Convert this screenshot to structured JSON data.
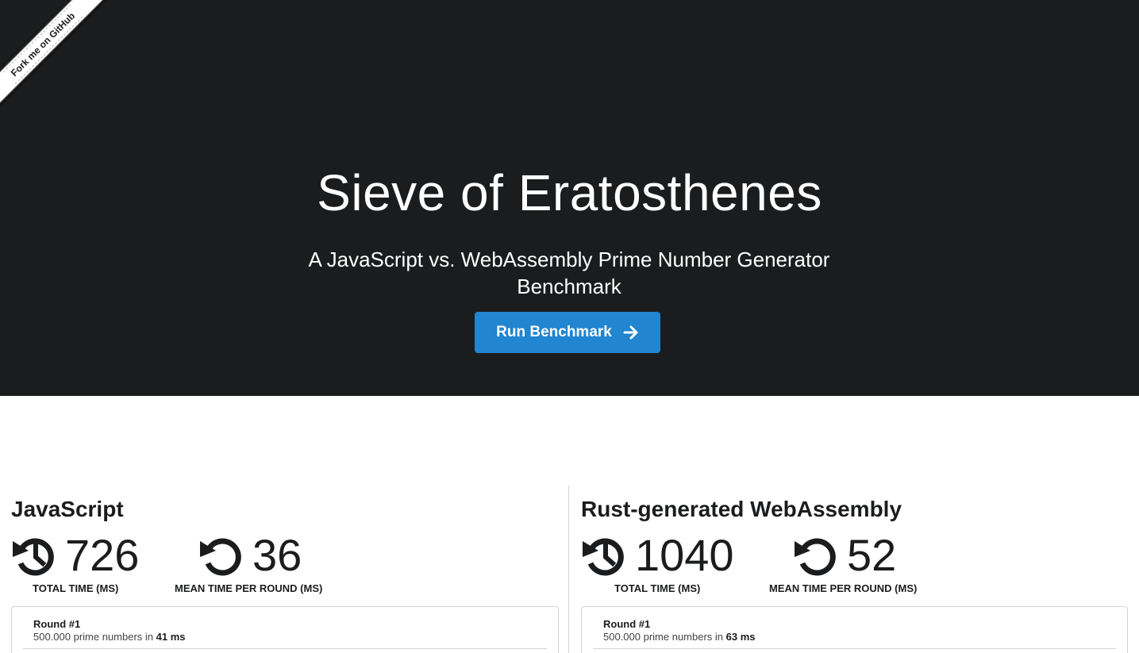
{
  "ribbon": {
    "label": "Fork me on GitHub"
  },
  "hero": {
    "title": "Sieve of Eratosthenes",
    "subtitle": "A JavaScript vs. WebAssembly Prime Number Generator Benchmark",
    "button_label": "Run Benchmark",
    "button_icon": "arrow-right-icon",
    "background": "#1b1c1d",
    "accent": "#2185d0"
  },
  "javascript": {
    "title": "JavaScript",
    "total_time": "726",
    "total_label": "TOTAL TIME (MS)",
    "mean_time": "36",
    "mean_label": "MEAN TIME PER ROUND (MS)",
    "rounds": [
      {
        "title": "Round #1",
        "text": "500.000 prime numbers in ",
        "time": "41 ms"
      }
    ]
  },
  "wasm": {
    "title": "Rust-generated WebAssembly",
    "total_time": "1040",
    "total_label": "TOTAL TIME (MS)",
    "mean_time": "52",
    "mean_label": "MEAN TIME PER ROUND (MS)",
    "rounds": [
      {
        "title": "Round #1",
        "text": "500.000 prime numbers in ",
        "time": "63 ms"
      }
    ]
  }
}
